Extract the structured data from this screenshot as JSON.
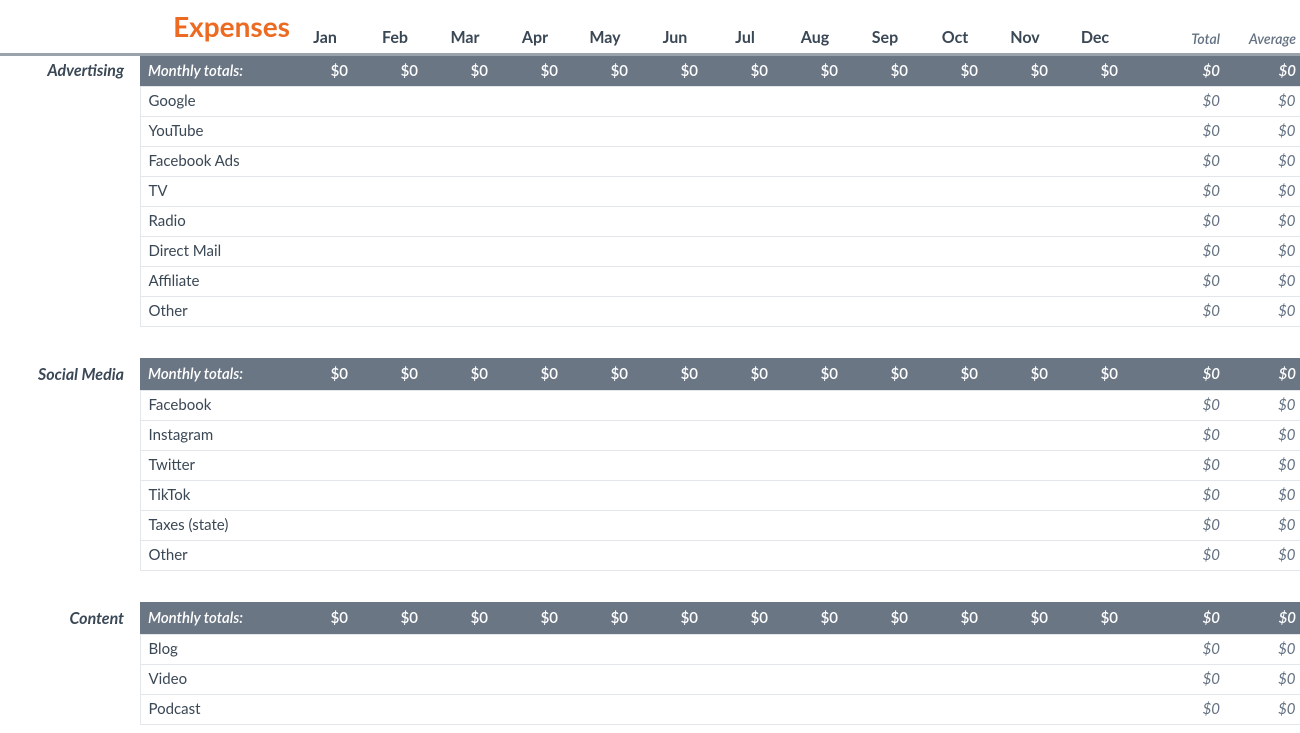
{
  "title": "Expenses",
  "months": [
    "Jan",
    "Feb",
    "Mar",
    "Apr",
    "May",
    "Jun",
    "Jul",
    "Aug",
    "Sep",
    "Oct",
    "Nov",
    "Dec"
  ],
  "summary_headers": {
    "total": "Total",
    "average": "Average"
  },
  "totals_row_label": "Monthly totals:",
  "selected_cell": {
    "category_index": 0,
    "item_index": 2,
    "col": "avg"
  },
  "categories": [
    {
      "name": "Advertising",
      "monthly_totals": [
        "$0",
        "$0",
        "$0",
        "$0",
        "$0",
        "$0",
        "$0",
        "$0",
        "$0",
        "$0",
        "$0",
        "$0"
      ],
      "grand_total": "$0",
      "grand_average": "$0",
      "items": [
        {
          "label": "Google",
          "values": [
            "",
            "",
            "",
            "",
            "",
            "",
            "",
            "",
            "",
            "",
            "",
            ""
          ],
          "total": "$0",
          "average": "$0"
        },
        {
          "label": "YouTube",
          "values": [
            "",
            "",
            "",
            "",
            "",
            "",
            "",
            "",
            "",
            "",
            "",
            ""
          ],
          "total": "$0",
          "average": "$0"
        },
        {
          "label": "Facebook Ads",
          "values": [
            "",
            "",
            "",
            "",
            "",
            "",
            "",
            "",
            "",
            "",
            "",
            ""
          ],
          "total": "$0",
          "average": "$0"
        },
        {
          "label": "TV",
          "values": [
            "",
            "",
            "",
            "",
            "",
            "",
            "",
            "",
            "",
            "",
            "",
            ""
          ],
          "total": "$0",
          "average": "$0"
        },
        {
          "label": "Radio",
          "values": [
            "",
            "",
            "",
            "",
            "",
            "",
            "",
            "",
            "",
            "",
            "",
            ""
          ],
          "total": "$0",
          "average": "$0"
        },
        {
          "label": "Direct Mail",
          "values": [
            "",
            "",
            "",
            "",
            "",
            "",
            "",
            "",
            "",
            "",
            "",
            ""
          ],
          "total": "$0",
          "average": "$0"
        },
        {
          "label": "Affiliate",
          "values": [
            "",
            "",
            "",
            "",
            "",
            "",
            "",
            "",
            "",
            "",
            "",
            ""
          ],
          "total": "$0",
          "average": "$0"
        },
        {
          "label": "Other",
          "values": [
            "",
            "",
            "",
            "",
            "",
            "",
            "",
            "",
            "",
            "",
            "",
            ""
          ],
          "total": "$0",
          "average": "$0"
        }
      ]
    },
    {
      "name": "Social Media",
      "monthly_totals": [
        "$0",
        "$0",
        "$0",
        "$0",
        "$0",
        "$0",
        "$0",
        "$0",
        "$0",
        "$0",
        "$0",
        "$0"
      ],
      "grand_total": "$0",
      "grand_average": "$0",
      "items": [
        {
          "label": "Facebook",
          "values": [
            "",
            "",
            "",
            "",
            "",
            "",
            "",
            "",
            "",
            "",
            "",
            ""
          ],
          "total": "$0",
          "average": "$0"
        },
        {
          "label": "Instagram",
          "values": [
            "",
            "",
            "",
            "",
            "",
            "",
            "",
            "",
            "",
            "",
            "",
            ""
          ],
          "total": "$0",
          "average": "$0"
        },
        {
          "label": "Twitter",
          "values": [
            "",
            "",
            "",
            "",
            "",
            "",
            "",
            "",
            "",
            "",
            "",
            ""
          ],
          "total": "$0",
          "average": "$0"
        },
        {
          "label": "TikTok",
          "values": [
            "",
            "",
            "",
            "",
            "",
            "",
            "",
            "",
            "",
            "",
            "",
            ""
          ],
          "total": "$0",
          "average": "$0"
        },
        {
          "label": "Taxes (state)",
          "values": [
            "",
            "",
            "",
            "",
            "",
            "",
            "",
            "",
            "",
            "",
            "",
            ""
          ],
          "total": "$0",
          "average": "$0"
        },
        {
          "label": "Other",
          "values": [
            "",
            "",
            "",
            "",
            "",
            "",
            "",
            "",
            "",
            "",
            "",
            ""
          ],
          "total": "$0",
          "average": "$0"
        }
      ]
    },
    {
      "name": "Content",
      "monthly_totals": [
        "$0",
        "$0",
        "$0",
        "$0",
        "$0",
        "$0",
        "$0",
        "$0",
        "$0",
        "$0",
        "$0",
        "$0"
      ],
      "grand_total": "$0",
      "grand_average": "$0",
      "items": [
        {
          "label": "Blog",
          "values": [
            "",
            "",
            "",
            "",
            "",
            "",
            "",
            "",
            "",
            "",
            "",
            ""
          ],
          "total": "$0",
          "average": "$0"
        },
        {
          "label": "Video",
          "values": [
            "",
            "",
            "",
            "",
            "",
            "",
            "",
            "",
            "",
            "",
            "",
            ""
          ],
          "total": "$0",
          "average": "$0"
        },
        {
          "label": "Podcast",
          "values": [
            "",
            "",
            "",
            "",
            "",
            "",
            "",
            "",
            "",
            "",
            "",
            ""
          ],
          "total": "$0",
          "average": "$0"
        }
      ]
    }
  ]
}
